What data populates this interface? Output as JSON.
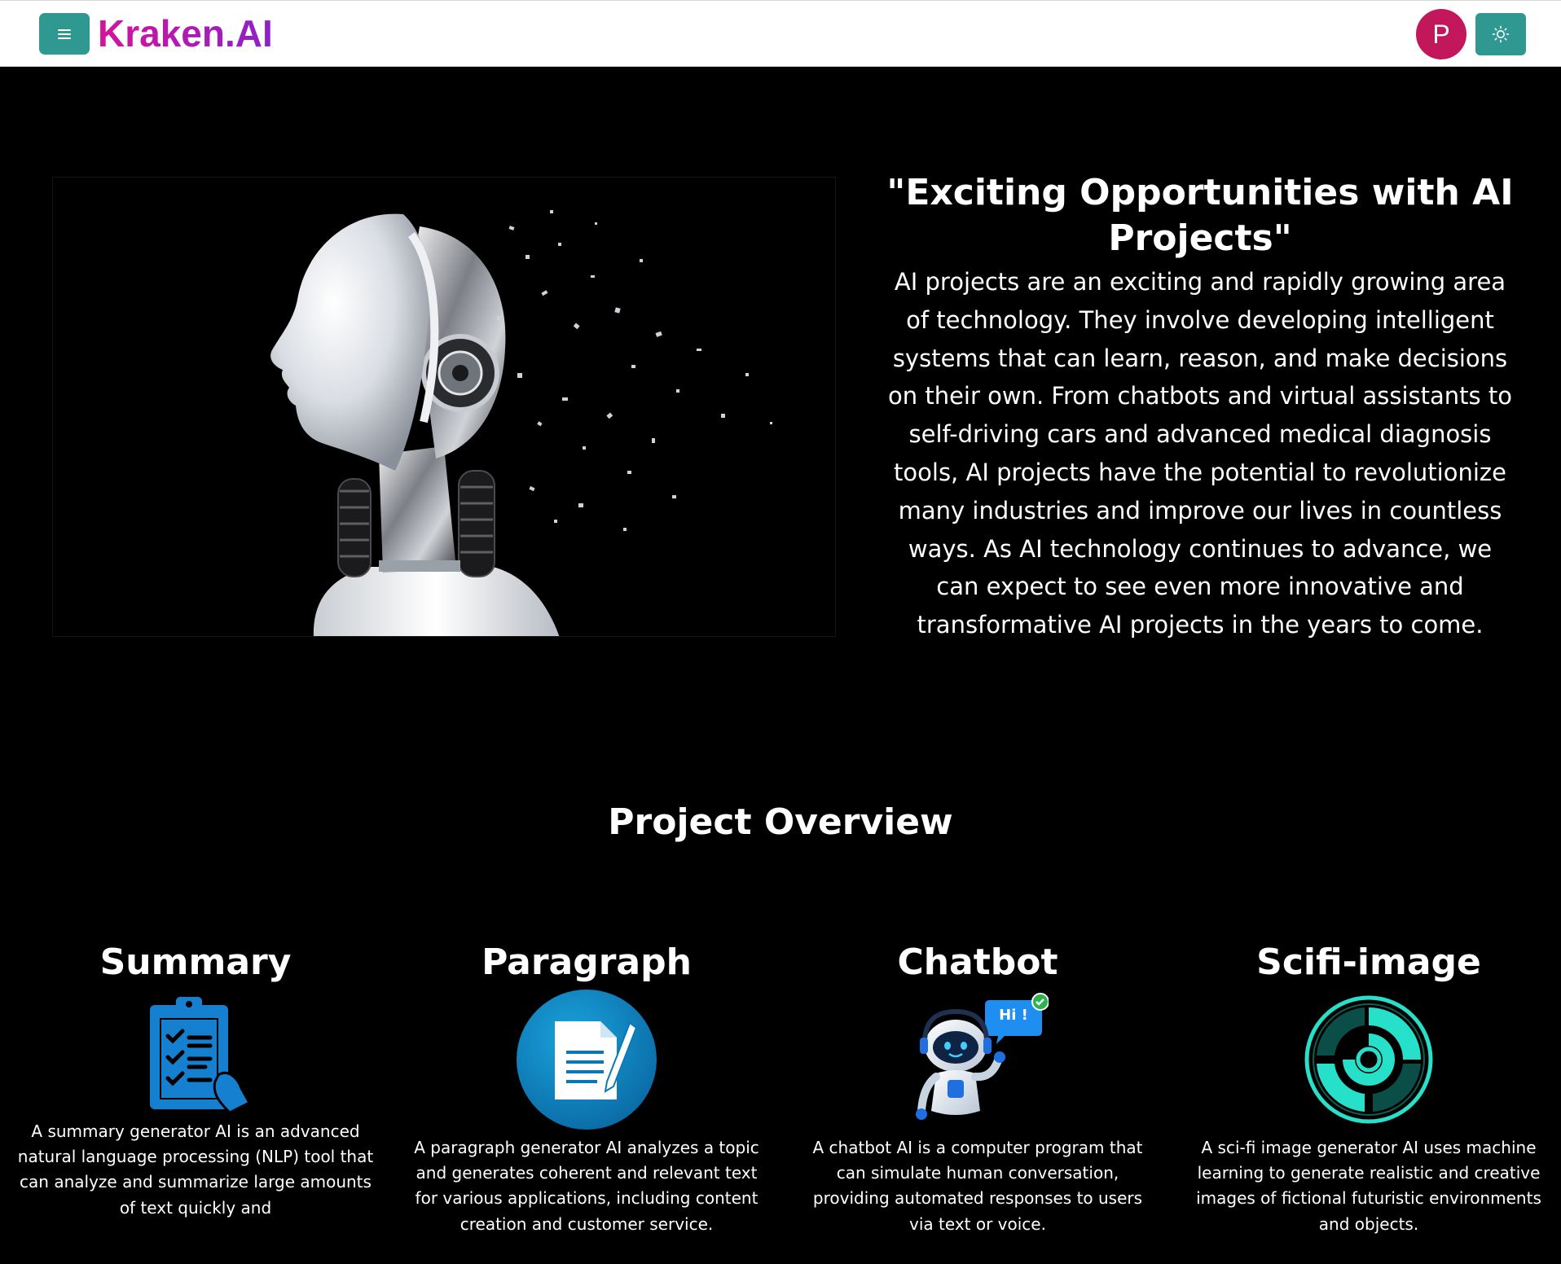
{
  "nav": {
    "brand": "Kraken.AI",
    "avatar_letter": "P",
    "icons": {
      "menu": "hamburger-icon",
      "theme": "sun-icon"
    },
    "colors": {
      "button": "#2e9891",
      "avatar": "#c2185b",
      "brand_gradient": [
        "#d6139b",
        "#8b22c7"
      ]
    }
  },
  "hero": {
    "image": "robot-head-disintegrating-illustration",
    "title": "\"Exciting Opportunities with AI Projects\"",
    "body": "AI projects are an exciting and rapidly growing area of technology. They involve developing intelligent systems that can learn, reason, and make decisions on their own. From chatbots and virtual assistants to self-driving cars and advanced medical diagnosis tools, AI projects have the potential to revolutionize many industries and improve our lives in countless ways. As AI technology continues to advance, we can expect to see even more innovative and transformative AI projects in the years to come."
  },
  "overview": {
    "title": "Project Overview",
    "cards": [
      {
        "title": "Summary",
        "icon": "clipboard-checklist-icon",
        "description": "A summary generator AI is an advanced natural language processing (NLP) tool that can analyze and summarize large amounts of text quickly and"
      },
      {
        "title": "Paragraph",
        "icon": "document-pen-icon",
        "description": "A paragraph generator AI analyzes a topic and generates coherent and relevant text for various applications, including content creation and customer service."
      },
      {
        "title": "Chatbot",
        "icon": "robot-chat-icon",
        "bubble_text": "Hi !",
        "description": "A chatbot AI is a computer program that can simulate human conversation, providing automated responses to users via text or voice."
      },
      {
        "title": "Scifi-image",
        "icon": "scifi-circle-icon",
        "description": "A sci-fi image generator AI uses machine learning to generate realistic and creative images of fictional futuristic environments and objects."
      }
    ]
  }
}
